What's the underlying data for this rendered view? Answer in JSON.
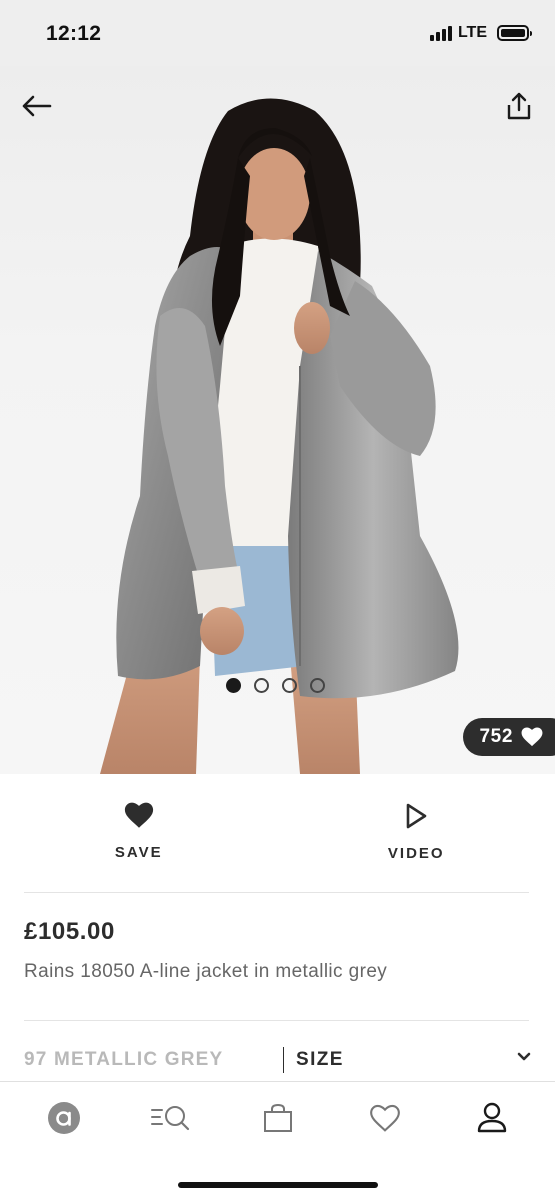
{
  "status_bar": {
    "time": "12:12",
    "network": "LTE"
  },
  "hero": {
    "image_alt": "model wearing metallic grey A-line jacket",
    "carousel": {
      "count": 4,
      "active_index": 0
    },
    "likes_count": "752"
  },
  "actions": {
    "save_label": "SAVE",
    "video_label": "VIDEO"
  },
  "product": {
    "price": "£105.00",
    "name": "Rains 18050 A-line jacket in metallic grey"
  },
  "selectors": {
    "colour": "97 METALLIC GREY",
    "size_label": "SIZE"
  },
  "bottom_nav": {
    "items": [
      {
        "icon": "home-icon",
        "active": true
      },
      {
        "icon": "search-icon",
        "active": false
      },
      {
        "icon": "bag-icon",
        "active": false
      },
      {
        "icon": "saved-heart-icon",
        "active": false
      },
      {
        "icon": "account-icon",
        "active": false
      }
    ]
  },
  "colors": {
    "text_primary": "#2d2d2d",
    "text_muted": "#b9b9b9",
    "badge_bg": "#2d2d2d"
  }
}
